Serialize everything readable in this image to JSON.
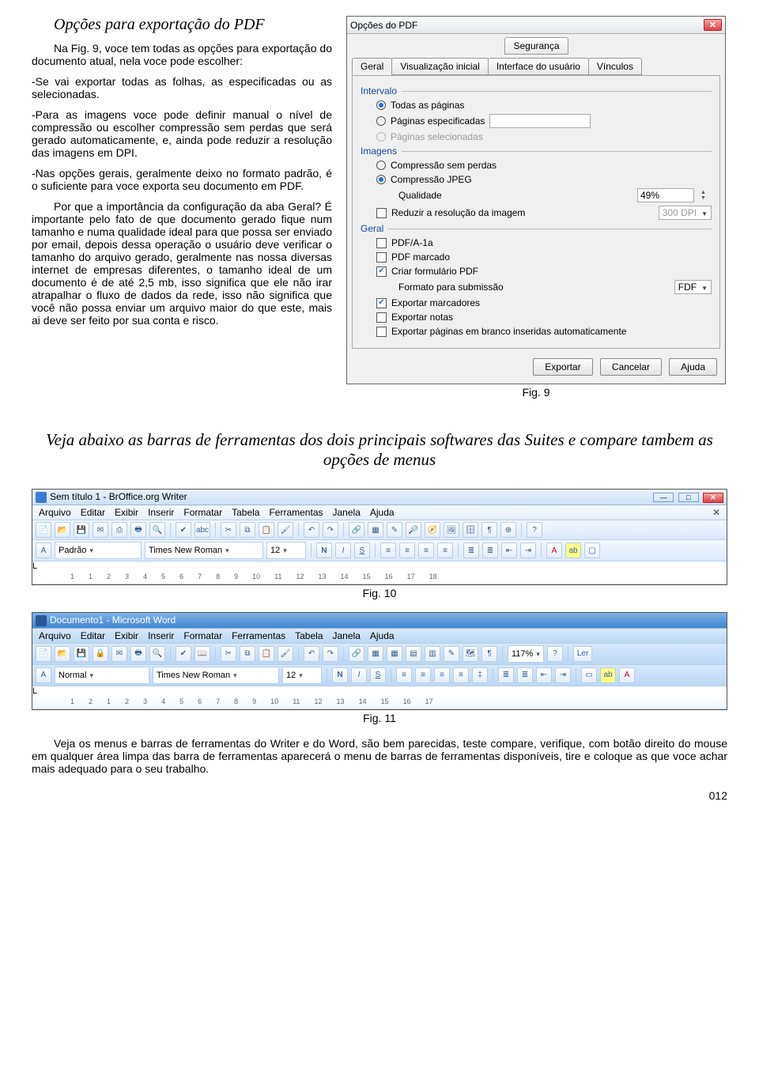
{
  "article": {
    "title": "Opções para exportação do PDF",
    "p1": "Na Fig. 9, voce tem todas as opções para exportação do documento atual, nela voce pode escolher:",
    "p2": "-Se vai exportar todas as folhas, as especificadas ou as selecionadas.",
    "p3": "-Para as imagens voce pode definir manual o nível de compressão ou escolher compressão sem perdas que será gerado automaticamente, e, ainda pode reduzir a resolução das imagens em DPI.",
    "p4": "-Nas opções gerais, geralmente deixo no formato padrão, é o suficiente para voce exporta seu documento em PDF.",
    "p5": "Por que a importância da configuração da aba Geral? É importante pelo fato de que documento gerado fique num tamanho e numa qualidade ideal para que possa ser enviado por email, depois dessa operação o usuário deve verificar o tamanho do arquivo gerado, geralmente nas nossa diversas internet de empresas diferentes, o tamanho ideal de um documento é de até 2,5 mb, isso significa que ele não irar atrapalhar o fluxo de dados da rede, isso não significa que você não possa enviar um arquivo maior do que este, mais ai deve ser feito por sua conta e risco.",
    "fig9": "Fig. 9",
    "compare_heading": "Veja abaixo as barras de ferramentas dos dois principais softwares das Suites e compare tambem as opções de menus",
    "fig10": "Fig. 10",
    "fig11": "Fig. 11",
    "bottom": "Veja os menus e barras de ferramentas do Writer e do Word, são bem parecidas, teste compare, verifique, com botão direito do mouse em qualquer área limpa das barra de ferramentas aparecerá o menu de barras de ferramentas disponíveis, tire e coloque as que voce achar mais adequado para o seu trabalho.",
    "pagenum": "012"
  },
  "dialog": {
    "title": "Opções do PDF",
    "tab_top": "Segurança",
    "tabs": [
      "Geral",
      "Visualização inicial",
      "Interface do usuário",
      "Vínculos"
    ],
    "grp_intervalo": "Intervalo",
    "radio_all": "Todas as páginas",
    "radio_pages": "Páginas especificadas",
    "radio_sel": "Páginas selecionadas",
    "grp_imagens": "Imagens",
    "radio_lossless": "Compressão sem perdas",
    "radio_jpeg": "Compressão JPEG",
    "lbl_qualidade": "Qualidade",
    "val_qualidade": "49%",
    "chk_reduzir": "Reduzir a resolução da imagem",
    "val_dpi": "300 DPI",
    "grp_geral": "Geral",
    "chk_pdfa": "PDF/A-1a",
    "chk_marcado": "PDF marcado",
    "chk_form": "Criar formulário PDF",
    "lbl_formato": "Formato para submissão",
    "val_formato": "FDF",
    "chk_bookmarks": "Exportar marcadores",
    "chk_notas": "Exportar notas",
    "chk_blank": "Exportar páginas em branco inseridas automaticamente",
    "btn_export": "Exportar",
    "btn_cancel": "Cancelar",
    "btn_help": "Ajuda"
  },
  "writer": {
    "title": "Sem título 1 - BrOffice.org Writer",
    "menus": [
      "Arquivo",
      "Editar",
      "Exibir",
      "Inserir",
      "Formatar",
      "Tabela",
      "Ferramentas",
      "Janela",
      "Ajuda"
    ],
    "style": "Padrão",
    "font": "Times New Roman",
    "size": "12",
    "ruler": [
      "1",
      "1",
      "2",
      "3",
      "4",
      "5",
      "6",
      "7",
      "8",
      "9",
      "10",
      "11",
      "12",
      "13",
      "14",
      "15",
      "16",
      "17",
      "18"
    ]
  },
  "word": {
    "title": "Documento1 - Microsoft Word",
    "menus": [
      "Arquivo",
      "Editar",
      "Exibir",
      "Inserir",
      "Formatar",
      "Ferramentas",
      "Tabela",
      "Janela",
      "Ajuda"
    ],
    "style": "Normal",
    "font": "Times New Roman",
    "size": "12",
    "zoom": "117%",
    "ruler": [
      "1",
      "2",
      "1",
      "2",
      "3",
      "4",
      "5",
      "6",
      "7",
      "8",
      "9",
      "10",
      "11",
      "12",
      "13",
      "14",
      "15",
      "16",
      "17"
    ]
  }
}
